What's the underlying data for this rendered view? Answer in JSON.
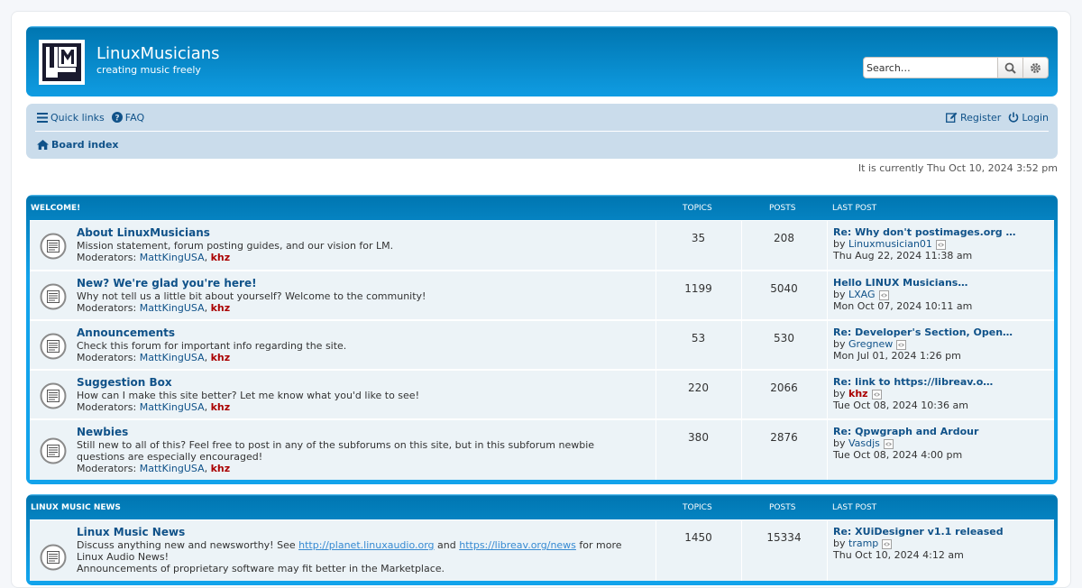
{
  "site": {
    "title": "LinuxMusicians",
    "description": "creating music freely",
    "logo_letters": "LM"
  },
  "search": {
    "placeholder": "Search…",
    "value": "Search…"
  },
  "nav": {
    "quick_links": "Quick links",
    "faq": "FAQ",
    "register": "Register",
    "login": "Login",
    "board_index": "Board index"
  },
  "time_text": "It is currently Thu Oct 10, 2024 3:52 pm",
  "categories": [
    {
      "title": "WELCOME!",
      "col_topics": "TOPICS",
      "col_posts": "POSTS",
      "col_lastpost": "LAST POST",
      "forums": [
        {
          "title": "About LinuxMusicians",
          "description": "Mission statement, forum posting guides, and our vision for LM.",
          "moderators_label": "Moderators:",
          "moderators": [
            "MattKingUSA",
            "khz"
          ],
          "topics": "35",
          "posts": "208",
          "lastpost": {
            "title": "Re: Why don't postimages.org …",
            "by_label": "by",
            "author": "Linuxmusician01",
            "date": "Thu Aug 22, 2024 11:38 am"
          }
        },
        {
          "title": "New? We're glad you're here!",
          "description": "Why not tell us a little bit about yourself? Welcome to the community!",
          "moderators_label": "Moderators:",
          "moderators": [
            "MattKingUSA",
            "khz"
          ],
          "topics": "1199",
          "posts": "5040",
          "lastpost": {
            "title": "Hello LINUX Musicians…",
            "by_label": "by",
            "author": "LXAG",
            "date": "Mon Oct 07, 2024 10:11 am"
          }
        },
        {
          "title": "Announcements",
          "description": "Check this forum for important info regarding the site.",
          "moderators_label": "Moderators:",
          "moderators": [
            "MattKingUSA",
            "khz"
          ],
          "topics": "53",
          "posts": "530",
          "lastpost": {
            "title": "Re: Developer's Section, Open…",
            "by_label": "by",
            "author": "Gregnew",
            "date": "Mon Jul 01, 2024 1:26 pm"
          }
        },
        {
          "title": "Suggestion Box",
          "description": "How can I make this site better? Let me know what you'd like to see!",
          "moderators_label": "Moderators:",
          "moderators": [
            "MattKingUSA",
            "khz"
          ],
          "topics": "220",
          "posts": "2066",
          "lastpost": {
            "title": "Re: link to https://libreav.o…",
            "by_label": "by",
            "author": "khz",
            "date": "Tue Oct 08, 2024 10:36 am"
          }
        },
        {
          "title": "Newbies",
          "description_1": "Still new to all of this? Feel free to post in any of the subforums on this site, but in this subforum newbie",
          "description_2": "questions are especially encouraged!",
          "moderators_label": "Moderators:",
          "moderators": [
            "MattKingUSA",
            "khz"
          ],
          "topics": "380",
          "posts": "2876",
          "lastpost": {
            "title": "Re: Qpwgraph and Ardour",
            "by_label": "by",
            "author": "Vasdjs",
            "date": "Tue Oct 08, 2024 4:00 pm"
          }
        }
      ]
    },
    {
      "title": "LINUX MUSIC NEWS",
      "col_topics": "TOPICS",
      "col_posts": "POSTS",
      "col_lastpost": "LAST POST",
      "forums": [
        {
          "title": "Linux Music News",
          "desc_a": "Discuss anything new and newsworthy! See ",
          "link_1": "http://planet.linuxaudio.org",
          "desc_b": " and ",
          "link_2": "https://libreav.org/news",
          "desc_c": " for more",
          "desc_line2": "Linux Audio News!",
          "desc_line3": "Announcements of proprietary software may fit better in the Marketplace.",
          "topics": "1450",
          "posts": "15334",
          "lastpost": {
            "title": "Re: XUiDesigner v1.1 released",
            "by_label": "by",
            "author": "tramp",
            "date": "Thu Oct 10, 2024 4:12 am"
          }
        }
      ]
    }
  ]
}
